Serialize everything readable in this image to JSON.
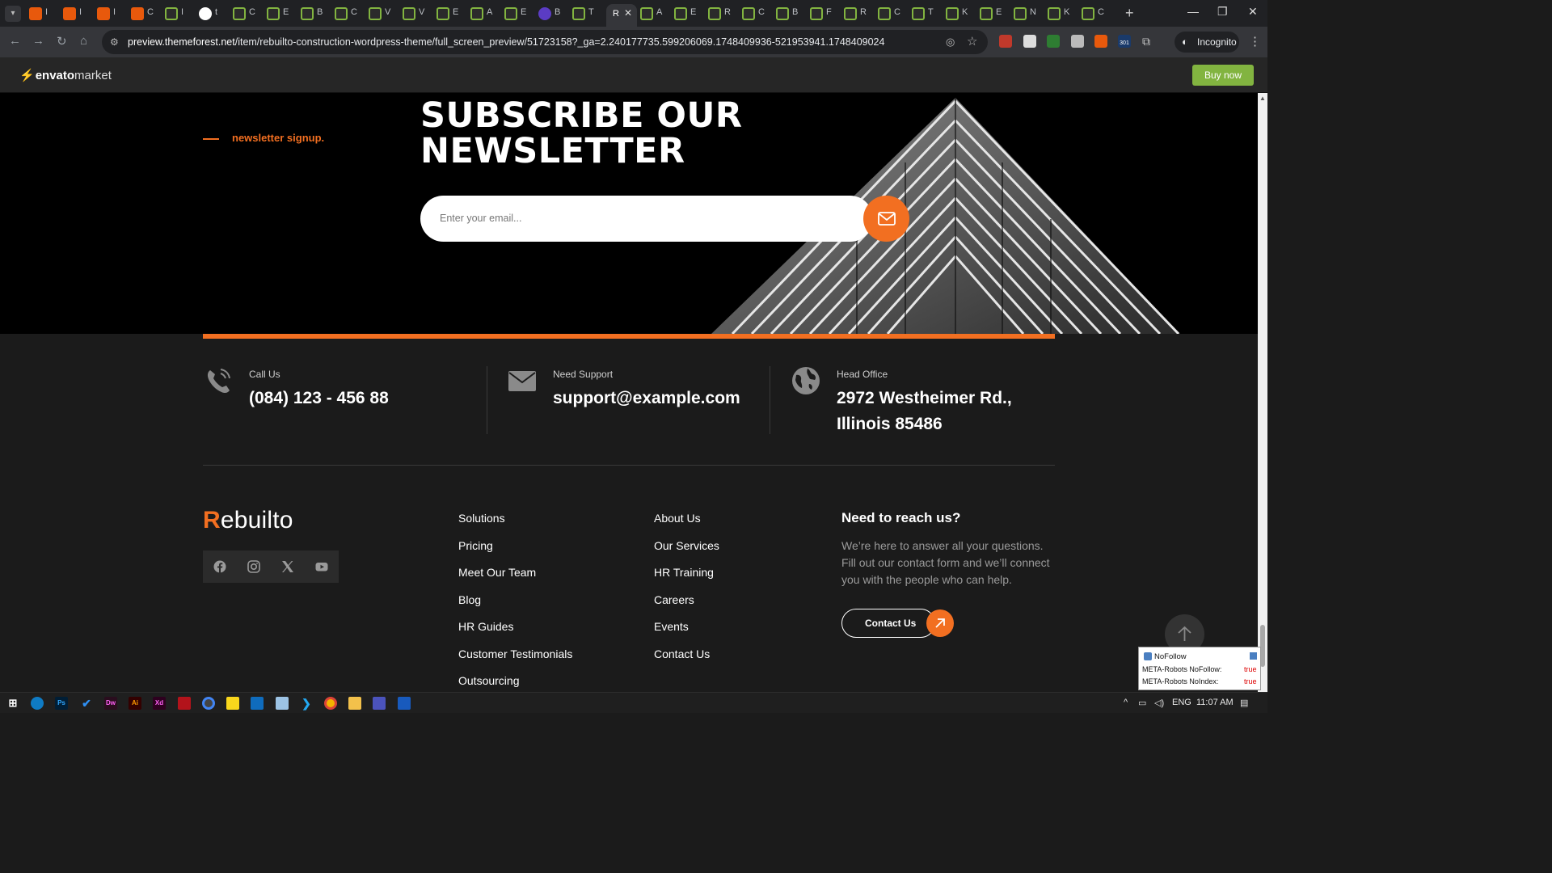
{
  "browser": {
    "tabs": [
      {
        "icon": "envato-orange-icon",
        "label": "I"
      },
      {
        "icon": "envato-orange-icon",
        "label": "I"
      },
      {
        "icon": "envato-orange-icon",
        "label": "I"
      },
      {
        "icon": "envato-orange-icon",
        "label": "C"
      },
      {
        "icon": "envato-green-icon",
        "label": "I"
      },
      {
        "icon": "google-icon",
        "label": "t"
      },
      {
        "icon": "envato-green-icon",
        "label": "C"
      },
      {
        "icon": "envato-green-icon",
        "label": "E"
      },
      {
        "icon": "envato-green-icon",
        "label": "B"
      },
      {
        "icon": "envato-green-icon",
        "label": "C"
      },
      {
        "icon": "envato-green-icon",
        "label": "V"
      },
      {
        "icon": "envato-green-icon",
        "label": "V"
      },
      {
        "icon": "envato-green-icon",
        "label": "E"
      },
      {
        "icon": "envato-green-icon",
        "label": "A"
      },
      {
        "icon": "envato-green-icon",
        "label": "E"
      },
      {
        "icon": "purple-icon",
        "label": "B"
      },
      {
        "icon": "envato-green-icon",
        "label": "T"
      },
      {
        "icon": "rebuilto-icon",
        "label": "R",
        "active": true
      },
      {
        "icon": "envato-green-icon",
        "label": "A"
      },
      {
        "icon": "envato-green-icon",
        "label": "E"
      },
      {
        "icon": "envato-green-icon",
        "label": "R"
      },
      {
        "icon": "envato-green-icon",
        "label": "C"
      },
      {
        "icon": "envato-green-icon",
        "label": "B"
      },
      {
        "icon": "envato-green-icon",
        "label": "F"
      },
      {
        "icon": "envato-green-icon",
        "label": "R"
      },
      {
        "icon": "envato-green-icon",
        "label": "C"
      },
      {
        "icon": "envato-green-icon",
        "label": "T"
      },
      {
        "icon": "envato-green-icon",
        "label": "K"
      },
      {
        "icon": "envato-green-icon",
        "label": "E"
      },
      {
        "icon": "envato-green-icon",
        "label": "N"
      },
      {
        "icon": "envato-green-icon",
        "label": "K"
      },
      {
        "icon": "envato-green-icon",
        "label": "C"
      }
    ],
    "url_host": "preview.themeforest.net",
    "url_path": "/item/rebuilto-construction-wordpress-theme/full_screen_preview/51723158?_ga=2.240177735.599206069.1748409936-521953941.1748409024",
    "incognito_label": "Incognito",
    "extension_badge": "301"
  },
  "envato": {
    "logo_bold": "envato",
    "logo_light": "market",
    "buy_label": "Buy now"
  },
  "newsletter": {
    "label": "newsletter signup.",
    "title_line1": "SUBSCRIBE OUR",
    "title_line2": "NEWSLETTER",
    "email_placeholder": "Enter your email..."
  },
  "contacts": [
    {
      "label": "Call Us",
      "value_line1": "(084) 123 - 456 88",
      "value_line2": ""
    },
    {
      "label": "Need Support",
      "value_line1": "support@example.com",
      "value_line2": ""
    },
    {
      "label": "Head Office",
      "value_line1": "2972 Westheimer Rd.,",
      "value_line2": "Illinois 85486"
    }
  ],
  "footer": {
    "brand_initial": "R",
    "brand_rest": "ebuilto",
    "social": [
      "facebook-icon",
      "instagram-icon",
      "x-icon",
      "youtube-icon"
    ],
    "col1": [
      "Solutions",
      "Pricing",
      "Meet Our Team",
      "Blog",
      "HR Guides",
      "Customer Testimonials",
      "Outsourcing"
    ],
    "col2": [
      "About Us",
      "Our Services",
      "HR Training",
      "Careers",
      "Events",
      "Contact Us"
    ],
    "reach_title": "Need to reach us?",
    "reach_text": "We’re here to answer all your questions. Fill out our contact form and we’ll connect you with the people who can help.",
    "contact_button": "Contact Us"
  },
  "nofollow_ext": {
    "title": "NoFollow",
    "row1_label": "META-Robots NoFollow:",
    "row1_value": "true",
    "row2_label": "META-Robots NoIndex:",
    "row2_value": "true"
  },
  "taskbar": {
    "apps": [
      "windows-start",
      "edge",
      "photoshop",
      "todo",
      "dreamweaver",
      "illustrator",
      "xd",
      "filezilla",
      "chrome-active",
      "sticky-notes",
      "outlook",
      "notepad",
      "vscode",
      "chrome",
      "file-explorer",
      "teams",
      "word"
    ],
    "ps_label": "Ps",
    "dw_label": "Dw",
    "ai_label": "Ai",
    "xd_label": "Xd",
    "language": "ENG",
    "time": "11:07 AM"
  },
  "colors": {
    "accent": "#f26f21",
    "envato_green": "#82b440",
    "page_bg": "#1b1b1b"
  }
}
